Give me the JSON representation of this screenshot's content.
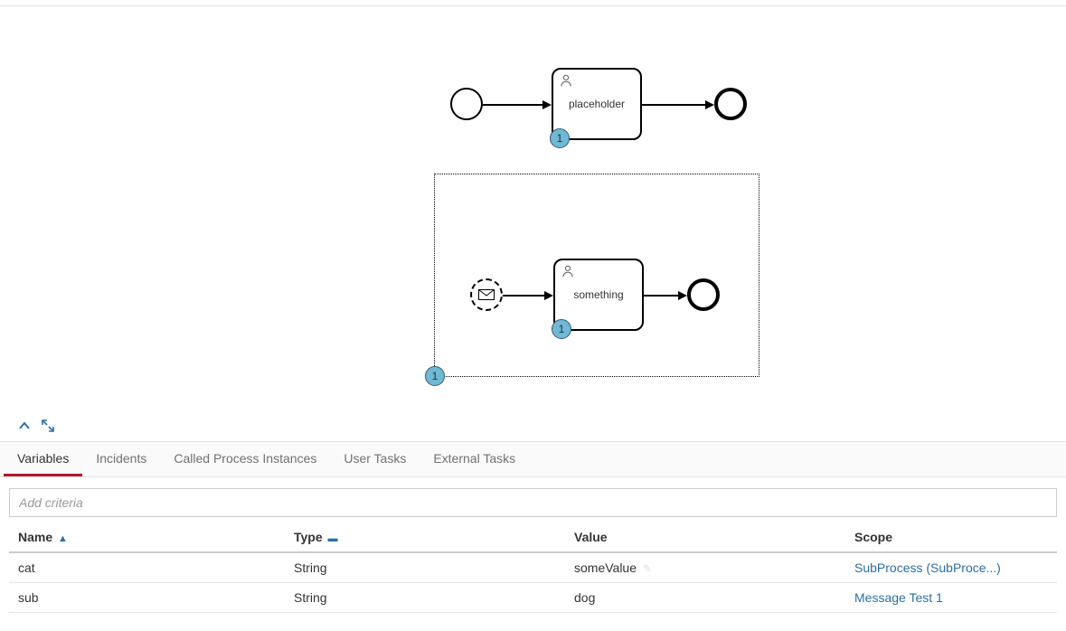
{
  "diagram": {
    "top_flow": {
      "task_label": "placeholder",
      "task_badge": "1"
    },
    "subprocess": {
      "task_label": "something",
      "task_badge": "1",
      "container_badge": "1"
    }
  },
  "controls": {
    "collapse_icon": "collapse",
    "expand_icon": "expand"
  },
  "tabs": [
    {
      "label": "Variables",
      "active": true
    },
    {
      "label": "Incidents",
      "active": false
    },
    {
      "label": "Called Process Instances",
      "active": false
    },
    {
      "label": "User Tasks",
      "active": false
    },
    {
      "label": "External Tasks",
      "active": false
    }
  ],
  "filter": {
    "placeholder": "Add criteria"
  },
  "columns": {
    "name": "Name",
    "type": "Type",
    "value": "Value",
    "scope": "Scope",
    "sort_name_indicator": "▲",
    "sort_type_indicator": "▬"
  },
  "rows": [
    {
      "name": "cat",
      "type": "String",
      "value": "someValue",
      "scope": "SubProcess (SubProce...)"
    },
    {
      "name": "sub",
      "type": "String",
      "value": "dog",
      "scope": "Message Test 1"
    }
  ]
}
